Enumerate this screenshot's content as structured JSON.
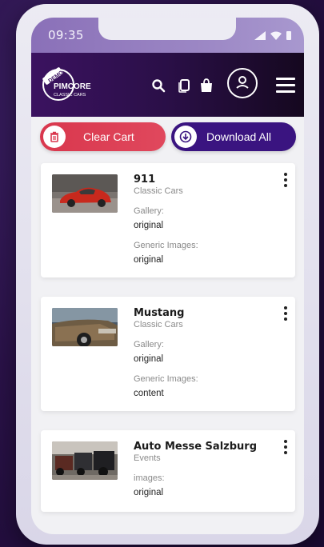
{
  "status_bar": {
    "time": "09:35"
  },
  "header": {
    "logo_badge": "DEMO",
    "logo_brand": "PIMCORE",
    "logo_tagline": "CLASSIC CARS",
    "icons": [
      "search-icon",
      "copy-icon",
      "shopping-bag-icon",
      "user-icon",
      "hamburger-menu-icon"
    ]
  },
  "actions": {
    "clear_label": "Clear Cart",
    "download_label": "Download All"
  },
  "cart_items": [
    {
      "title": "911",
      "subtitle": "Classic Cars",
      "fields": [
        {
          "label": "Gallery:",
          "value": "original"
        },
        {
          "label": "Generic Images:",
          "value": "original"
        }
      ]
    },
    {
      "title": "Mustang",
      "subtitle": "Classic Cars",
      "fields": [
        {
          "label": "Gallery:",
          "value": "original"
        },
        {
          "label": "Generic Images:",
          "value": "content"
        }
      ]
    },
    {
      "title": "Auto Messe Salzburg",
      "subtitle": "Events",
      "fields": [
        {
          "label": "images:",
          "value": "original"
        }
      ]
    }
  ],
  "colors": {
    "accent_red": "#d9374d",
    "accent_purple": "#3a1480",
    "navbar_dark": "#2a0f47"
  }
}
